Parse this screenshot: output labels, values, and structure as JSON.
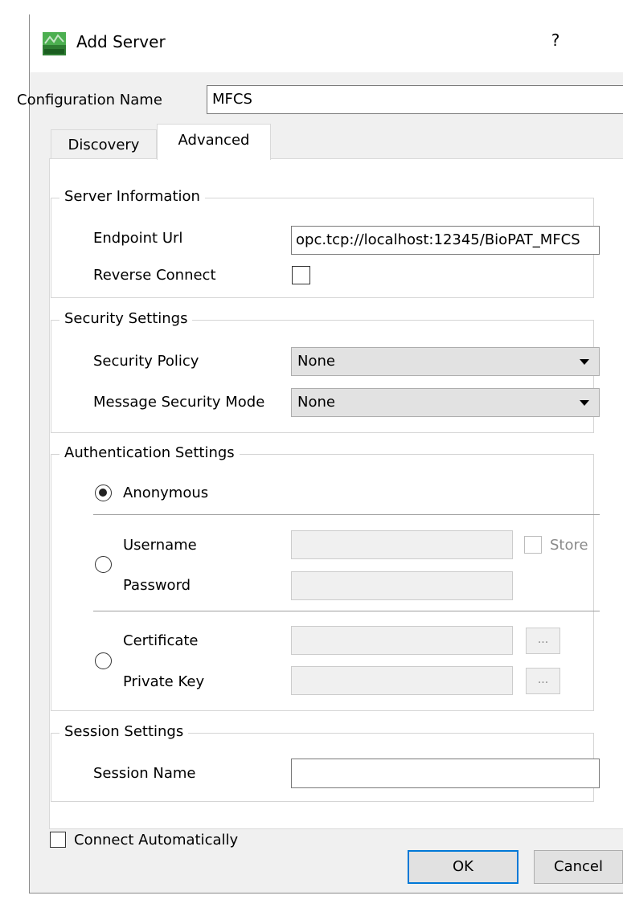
{
  "window": {
    "title": "Add Server",
    "help_label": "?"
  },
  "config": {
    "label": "Configuration Name",
    "value": "MFCS"
  },
  "tabs": [
    {
      "label": "Discovery"
    },
    {
      "label": "Advanced"
    }
  ],
  "server_info": {
    "title": "Server Information",
    "endpoint_label": "Endpoint Url",
    "endpoint_value": "opc.tcp://localhost:12345/BioPAT_MFCS",
    "reverse_label": "Reverse Connect"
  },
  "security": {
    "title": "Security Settings",
    "policy_label": "Security Policy",
    "policy_value": "None",
    "mode_label": "Message Security Mode",
    "mode_value": "None"
  },
  "auth": {
    "title": "Authentication Settings",
    "anonymous_label": "Anonymous",
    "username_label": "Username",
    "password_label": "Password",
    "store_label": "Store",
    "certificate_label": "Certificate",
    "private_key_label": "Private Key",
    "browse_label": "..."
  },
  "session": {
    "title": "Session Settings",
    "name_label": "Session Name"
  },
  "footer": {
    "connect_auto_label": "Connect Automatically",
    "ok_label": "OK",
    "cancel_label": "Cancel"
  },
  "icons": {
    "app_icon": "green-app-icon",
    "dropdown_icon": "chevron-down-icon"
  },
  "colors": {
    "accent": "#0078d7",
    "app_icon_green": "#3a8a2a"
  }
}
